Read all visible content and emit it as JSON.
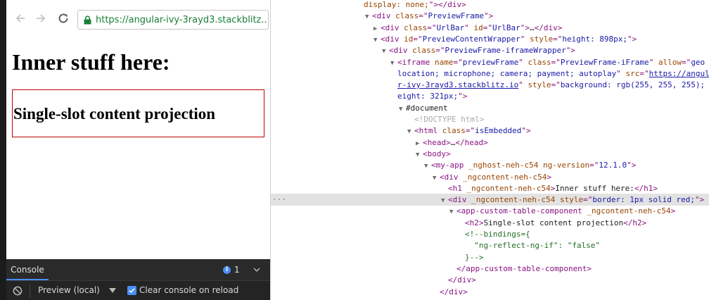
{
  "browser": {
    "url": "https://angular-ivy-3rayd3.stackblitz...."
  },
  "preview": {
    "heading": "Inner stuff here:",
    "projection_heading": "Single-slot content projection"
  },
  "console": {
    "tab_label": "Console",
    "issues_count": "1",
    "context_label": "Preview (local)",
    "clear_on_reload_label": "Clear console on reload",
    "clear_on_reload_checked": true
  },
  "accent_colors": {
    "url_green": "#188038",
    "border_red": "#c00000",
    "tab_blue": "#4a8ff7"
  },
  "elements_tree": {
    "lines": [
      {
        "indent": 0,
        "arrow": "",
        "html": "<span class=\"an\">display: none;</span><span class=\"tag\">\"&gt;&lt;/div&gt;</span>"
      },
      {
        "indent": 1,
        "arrow": "▼",
        "html": "<span class=\"tag\">&lt;div </span><span class=\"an\">class</span><span class=\"tag\">=\"</span><span class=\"av\">PreviewFrame</span><span class=\"tag\">\"&gt;</span>"
      },
      {
        "indent": 2,
        "arrow": "▶",
        "html": "<span class=\"tag\">&lt;div </span><span class=\"an\">class</span><span class=\"tag\">=\"</span><span class=\"av\">UrlBar</span><span class=\"tag\">\" </span><span class=\"an\">id</span><span class=\"tag\">=\"</span><span class=\"av\">UrlBar</span><span class=\"tag\">\"&gt;</span><span class=\"txt\">…</span><span class=\"tag\">&lt;/div&gt;</span>"
      },
      {
        "indent": 2,
        "arrow": "▼",
        "html": "<span class=\"tag\">&lt;div </span><span class=\"an\">id</span><span class=\"tag\">=\"</span><span class=\"av\">PreviewContentWrapper</span><span class=\"tag\">\" </span><span class=\"an\">style</span><span class=\"tag\">=\"</span><span class=\"av\">height: 898px;</span><span class=\"tag\">\"&gt;</span>"
      },
      {
        "indent": 3,
        "arrow": "▼",
        "html": "<span class=\"tag\">&lt;div </span><span class=\"an\">class</span><span class=\"tag\">=\"</span><span class=\"av\">PreviewFrame-iframeWrapper</span><span class=\"tag\">\"&gt;</span>"
      },
      {
        "indent": 4,
        "arrow": "▼",
        "html": "<span class=\"tag\">&lt;iframe </span><span class=\"an\">name</span><span class=\"tag\">=\"</span><span class=\"av\">previewFrame</span><span class=\"tag\">\" </span><span class=\"an\">class</span><span class=\"tag\">=\"</span><span class=\"av\">PreviewFrame-iFrame</span><span class=\"tag\">\" </span><span class=\"an\">allow</span><span class=\"tag\">=\"</span><span class=\"av\">geo</span>"
      },
      {
        "indent": 4,
        "arrow": "",
        "html": "<span class=\"av\">location; microphone; camera; payment; autoplay</span><span class=\"tag\">\" </span><span class=\"an\">src</span><span class=\"tag\">=\"</span><span class=\"link\">https://angula</span>"
      },
      {
        "indent": 4,
        "arrow": "",
        "html": "<span class=\"link\">r-ivy-3rayd3.stackblitz.io</span><span class=\"tag\">\" </span><span class=\"an\">style</span><span class=\"tag\">=\"</span><span class=\"av\">background: rgb(255, 255, 255); h</span>"
      },
      {
        "indent": 4,
        "arrow": "",
        "html": "<span class=\"av\">eight: 321px;</span><span class=\"tag\">\"&gt;</span>"
      },
      {
        "indent": 5,
        "arrow": "▼",
        "html": "<span class=\"doc\">#document</span>"
      },
      {
        "indent": 6,
        "arrow": "",
        "html": "<span class=\"dt\">&lt;!DOCTYPE html&gt;</span>"
      },
      {
        "indent": 6,
        "arrow": "▼",
        "html": "<span class=\"tag\">&lt;html </span><span class=\"an\">class</span><span class=\"tag\">=\"</span><span class=\"av\">isEmbedded</span><span class=\"tag\">\"&gt;</span>"
      },
      {
        "indent": 7,
        "arrow": "▶",
        "html": "<span class=\"tag\">&lt;head&gt;</span><span class=\"txt\">…</span><span class=\"tag\">&lt;/head&gt;</span>"
      },
      {
        "indent": 7,
        "arrow": "▼",
        "html": "<span class=\"tag\">&lt;body&gt;</span>"
      },
      {
        "indent": 8,
        "arrow": "▼",
        "html": "<span class=\"tag\">&lt;my-app </span><span class=\"an\">_nghost-neh-c54 ng-version</span><span class=\"tag\">=\"</span><span class=\"av\">12.1.0</span><span class=\"tag\">\"&gt;</span>"
      },
      {
        "indent": 9,
        "arrow": "▼",
        "html": "<span class=\"tag\">&lt;div </span><span class=\"an\">_ngcontent-neh-c54</span><span class=\"tag\">&gt;</span>"
      },
      {
        "indent": 10,
        "arrow": "",
        "html": "<span class=\"tag\">&lt;h1 </span><span class=\"an\">_ngcontent-neh-c54</span><span class=\"tag\">&gt;</span><span class=\"txt\">Inner stuff here:</span><span class=\"tag\">&lt;/h1&gt;</span>"
      },
      {
        "indent": 10,
        "arrow": "▼",
        "selected": true,
        "html": "<span class=\"tag\">&lt;div </span><span class=\"an\">_ngcontent-neh-c54 style</span><span class=\"tag\">=\"</span><span class=\"av\">border: 1px solid red;</span><span class=\"tag\">\"&gt;</span>"
      },
      {
        "indent": 11,
        "arrow": "▼",
        "html": "<span class=\"tag\">&lt;app-custom-table-component </span><span class=\"an\">_ngcontent-neh-c54</span><span class=\"tag\">&gt;</span>"
      },
      {
        "indent": 12,
        "arrow": "",
        "html": "<span class=\"tag\">&lt;h2&gt;</span><span class=\"txt\">Single-slot content projection</span><span class=\"tag\">&lt;/h2&gt;</span>"
      },
      {
        "indent": 12,
        "arrow": "",
        "html": "<span class=\"cmt\">&lt;!--bindings={</span>"
      },
      {
        "indent": 12,
        "arrow": "",
        "html": "<span class=\"cmt\">  \"ng-reflect-ng-if\": \"false\"</span>"
      },
      {
        "indent": 12,
        "arrow": "",
        "html": "<span class=\"cmt\">}--&gt;</span>"
      },
      {
        "indent": 11,
        "arrow": "",
        "html": "<span class=\"tag\">&lt;/app-custom-table-component&gt;</span>"
      },
      {
        "indent": 10,
        "arrow": "",
        "html": "<span class=\"tag\">&lt;/div&gt;</span>"
      },
      {
        "indent": 9,
        "arrow": "",
        "html": "<span class=\"tag\">&lt;/div&gt;</span>"
      }
    ]
  }
}
